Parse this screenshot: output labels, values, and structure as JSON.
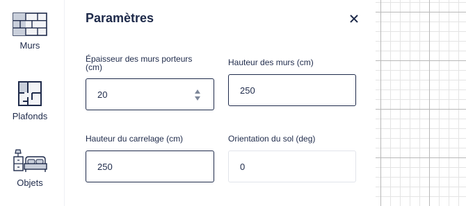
{
  "sidebar": {
    "items": [
      {
        "label": "Murs",
        "icon": "wall-icon"
      },
      {
        "label": "Plafonds",
        "icon": "floorplan-icon"
      },
      {
        "label": "Objets",
        "icon": "furniture-icon"
      }
    ]
  },
  "panel": {
    "title": "Paramètres",
    "close_icon": "close-icon",
    "fields": {
      "wall_thickness": {
        "label": "Épaisseur des murs porteurs (cm)",
        "value": "20"
      },
      "wall_height": {
        "label": "Hauteur des murs (cm)",
        "value": "250"
      },
      "tile_height": {
        "label": "Hauteur du carrelage (cm)",
        "value": "250"
      },
      "floor_orientation": {
        "label": "Orientation du sol (deg)",
        "value": "0"
      }
    }
  },
  "colors": {
    "text": "#1e2a4a",
    "field_border": "#1e2a4a",
    "inactive_border": "#e1e4ea",
    "grid_major": "#b8b8b8",
    "grid_minor": "#e4e4e4"
  }
}
